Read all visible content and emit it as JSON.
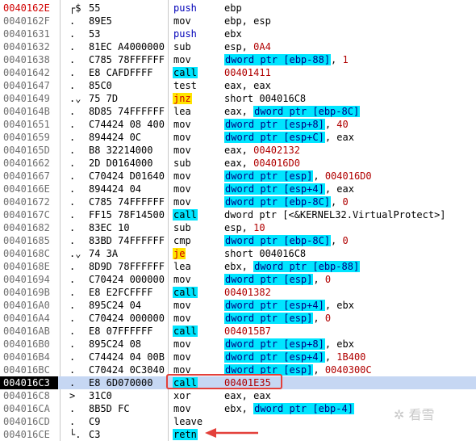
{
  "rows": [
    {
      "addr": "0040162E",
      "mark": "┌$",
      "hex": "55",
      "mn": "push",
      "op": [
        {
          "t": "ebp"
        }
      ],
      "addrStyle": "red",
      "mnStyle": "blue"
    },
    {
      "addr": "0040162F",
      "mark": ".",
      "hex": "89E5",
      "mn": "mov",
      "op": [
        {
          "t": "ebp, esp"
        }
      ]
    },
    {
      "addr": "00401631",
      "mark": ".",
      "hex": "53",
      "mn": "push",
      "op": [
        {
          "t": "ebx"
        }
      ],
      "mnStyle": "blue"
    },
    {
      "addr": "00401632",
      "mark": ".",
      "hex": "81EC A4000000",
      "mn": "sub",
      "op": [
        {
          "t": "esp, "
        },
        {
          "t": "0A4",
          "c": "imm"
        }
      ]
    },
    {
      "addr": "00401638",
      "mark": ".",
      "hex": "C785 78FFFFFF",
      "mn": "mov",
      "op": [
        {
          "t": "dword ptr [ebp-88]",
          "c": "cyan"
        },
        {
          "t": ", "
        },
        {
          "t": "1",
          "c": "imm"
        }
      ]
    },
    {
      "addr": "00401642",
      "mark": ".",
      "hex": "E8 CAFDFFFF",
      "mn": "call",
      "op": [
        {
          "t": "00401411",
          "c": "imm"
        }
      ],
      "mnStyle": "cyan"
    },
    {
      "addr": "00401647",
      "mark": ".",
      "hex": "85C0",
      "mn": "test",
      "op": [
        {
          "t": "eax, eax"
        }
      ]
    },
    {
      "addr": "00401649",
      "mark": ".⌄",
      "hex": "75 7D",
      "mn": "jnz",
      "op": [
        {
          "t": "short 004016C8"
        }
      ],
      "mnStyle": "yellow"
    },
    {
      "addr": "0040164B",
      "mark": ".",
      "hex": "8D85 74FFFFFF",
      "mn": "lea",
      "op": [
        {
          "t": "eax, "
        },
        {
          "t": "dword ptr [ebp-8C]",
          "c": "cyan"
        }
      ]
    },
    {
      "addr": "00401651",
      "mark": ".",
      "hex": "C74424 08 400",
      "mn": "mov",
      "op": [
        {
          "t": "dword ptr [esp+8]",
          "c": "cyan"
        },
        {
          "t": ", "
        },
        {
          "t": "40",
          "c": "imm"
        }
      ]
    },
    {
      "addr": "00401659",
      "mark": ".",
      "hex": "894424 0C",
      "mn": "mov",
      "op": [
        {
          "t": "dword ptr [esp+C]",
          "c": "cyan"
        },
        {
          "t": ", eax"
        }
      ]
    },
    {
      "addr": "0040165D",
      "mark": ".",
      "hex": "B8 32214000",
      "mn": "mov",
      "op": [
        {
          "t": "eax, "
        },
        {
          "t": "00402132",
          "c": "imm"
        }
      ]
    },
    {
      "addr": "00401662",
      "mark": ".",
      "hex": "2D D0164000",
      "mn": "sub",
      "op": [
        {
          "t": "eax, "
        },
        {
          "t": "004016D0",
          "c": "imm"
        }
      ]
    },
    {
      "addr": "00401667",
      "mark": ".",
      "hex": "C70424 D01640",
      "mn": "mov",
      "op": [
        {
          "t": "dword ptr [esp]",
          "c": "cyan"
        },
        {
          "t": ", "
        },
        {
          "t": "004016D0",
          "c": "imm"
        }
      ]
    },
    {
      "addr": "0040166E",
      "mark": ".",
      "hex": "894424 04",
      "mn": "mov",
      "op": [
        {
          "t": "dword ptr [esp+4]",
          "c": "cyan"
        },
        {
          "t": ", eax"
        }
      ]
    },
    {
      "addr": "00401672",
      "mark": ".",
      "hex": "C785 74FFFFFF",
      "mn": "mov",
      "op": [
        {
          "t": "dword ptr [ebp-8C]",
          "c": "cyan"
        },
        {
          "t": ", "
        },
        {
          "t": "0",
          "c": "imm"
        }
      ]
    },
    {
      "addr": "0040167C",
      "mark": ".",
      "hex": "FF15 78F14500",
      "mn": "call",
      "op": [
        {
          "t": "dword ptr [<&KERNEL32.VirtualProtect>]"
        }
      ],
      "mnStyle": "cyan"
    },
    {
      "addr": "00401682",
      "mark": ".",
      "hex": "83EC 10",
      "mn": "sub",
      "op": [
        {
          "t": "esp, "
        },
        {
          "t": "10",
          "c": "imm"
        }
      ]
    },
    {
      "addr": "00401685",
      "mark": ".",
      "hex": "83BD 74FFFFFF",
      "mn": "cmp",
      "op": [
        {
          "t": "dword ptr [ebp-8C]",
          "c": "cyan"
        },
        {
          "t": ", "
        },
        {
          "t": "0",
          "c": "imm"
        }
      ]
    },
    {
      "addr": "0040168C",
      "mark": ".⌄",
      "hex": "74 3A",
      "mn": "je",
      "op": [
        {
          "t": "short 004016C8"
        }
      ],
      "mnStyle": "yellow"
    },
    {
      "addr": "0040168E",
      "mark": ".",
      "hex": "8D9D 78FFFFFF",
      "mn": "lea",
      "op": [
        {
          "t": "ebx, "
        },
        {
          "t": "dword ptr [ebp-88]",
          "c": "cyan"
        }
      ]
    },
    {
      "addr": "00401694",
      "mark": ".",
      "hex": "C70424 000000",
      "mn": "mov",
      "op": [
        {
          "t": "dword ptr [esp]",
          "c": "cyan"
        },
        {
          "t": ", "
        },
        {
          "t": "0",
          "c": "imm"
        }
      ]
    },
    {
      "addr": "0040169B",
      "mark": ".",
      "hex": "E8 E2FCFFFF",
      "mn": "call",
      "op": [
        {
          "t": "00401382",
          "c": "imm"
        }
      ],
      "mnStyle": "cyan"
    },
    {
      "addr": "004016A0",
      "mark": ".",
      "hex": "895C24 04",
      "mn": "mov",
      "op": [
        {
          "t": "dword ptr [esp+4]",
          "c": "cyan"
        },
        {
          "t": ", ebx"
        }
      ]
    },
    {
      "addr": "004016A4",
      "mark": ".",
      "hex": "C70424 000000",
      "mn": "mov",
      "op": [
        {
          "t": "dword ptr [esp]",
          "c": "cyan"
        },
        {
          "t": ", "
        },
        {
          "t": "0",
          "c": "imm"
        }
      ]
    },
    {
      "addr": "004016AB",
      "mark": ".",
      "hex": "E8 07FFFFFF",
      "mn": "call",
      "op": [
        {
          "t": "004015B7",
          "c": "imm"
        }
      ],
      "mnStyle": "cyan"
    },
    {
      "addr": "004016B0",
      "mark": ".",
      "hex": "895C24 08",
      "mn": "mov",
      "op": [
        {
          "t": "dword ptr [esp+8]",
          "c": "cyan"
        },
        {
          "t": ", ebx"
        }
      ]
    },
    {
      "addr": "004016B4",
      "mark": ".",
      "hex": "C74424 04 00B",
      "mn": "mov",
      "op": [
        {
          "t": "dword ptr [esp+4]",
          "c": "cyan"
        },
        {
          "t": ", "
        },
        {
          "t": "1B400",
          "c": "imm"
        }
      ]
    },
    {
      "addr": "004016BC",
      "mark": ".",
      "hex": "C70424 0C3040",
      "mn": "mov",
      "op": [
        {
          "t": "dword ptr [esp]",
          "c": "cyan"
        },
        {
          "t": ", "
        },
        {
          "t": "0040300C",
          "c": "imm"
        }
      ]
    },
    {
      "addr": "004016C3",
      "mark": ".",
      "hex": "E8 6D070000",
      "mn": "call",
      "op": [
        {
          "t": "00401E35",
          "c": "imm"
        }
      ],
      "mnStyle": "cyan",
      "addrStyle": "cur",
      "selected": true
    },
    {
      "addr": "004016C8",
      "mark": ">",
      "hex": "31C0",
      "mn": "xor",
      "op": [
        {
          "t": "eax, eax"
        }
      ]
    },
    {
      "addr": "004016CA",
      "mark": ".",
      "hex": "8B5D FC",
      "mn": "mov",
      "op": [
        {
          "t": "ebx, "
        },
        {
          "t": "dword ptr [ebp-4]",
          "c": "cyan"
        }
      ]
    },
    {
      "addr": "004016CD",
      "mark": ".",
      "hex": "C9",
      "mn": "leave",
      "op": []
    },
    {
      "addr": "004016CE",
      "mark": "└.",
      "hex": "C3",
      "mn": "retn",
      "op": [],
      "mnStyle": "cyan"
    }
  ],
  "watermark": "✲ 看雪",
  "colors": {
    "accent_cyan": "#00e5ff",
    "jump_yellow": "#ffe400",
    "selected_row": "#c6d7f3",
    "annotation_red": "#e3403a"
  }
}
